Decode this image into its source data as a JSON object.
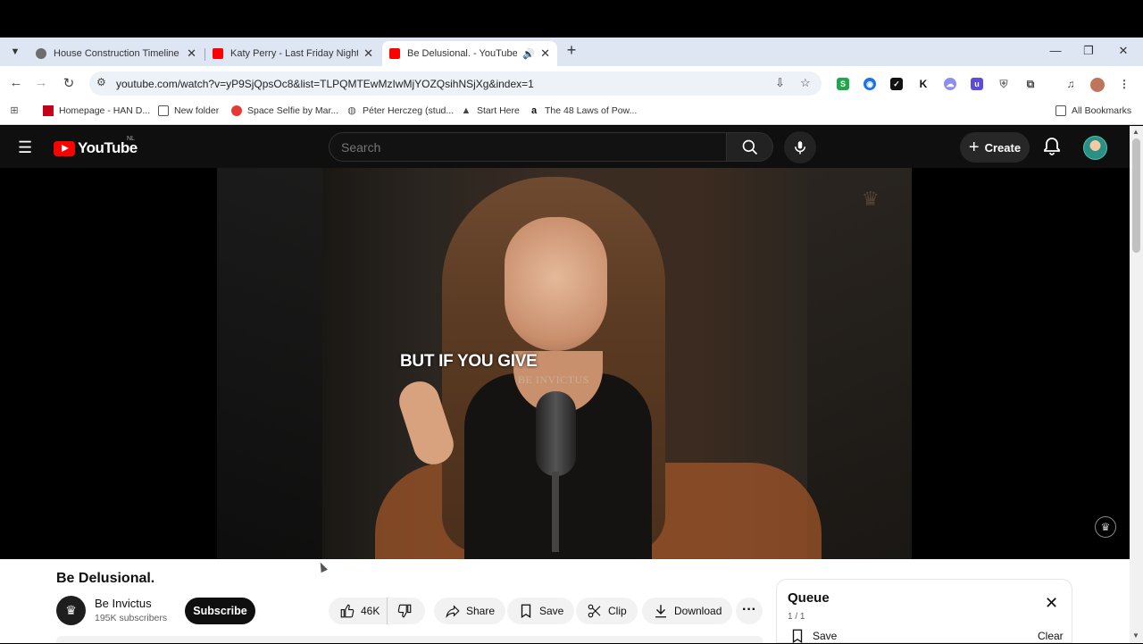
{
  "browser": {
    "tabs": [
      {
        "title": "House Construction Timeline",
        "favicon_color": "#6e6e6e",
        "active": false
      },
      {
        "title": "Katy Perry - Last Friday Night (T",
        "favicon_color": "#ff0000",
        "active": false
      },
      {
        "title": "Be Delusional. - YouTube",
        "favicon_color": "#ff0000",
        "active": true
      }
    ],
    "url": "youtube.com/watch?v=yP9SjQpsOc8&list=TLPQMTEwMzIwMjYOZQsihNSjXg&index=1",
    "bookmarks": [
      {
        "label": "Homepage - HAN D...",
        "icon": "han-icon"
      },
      {
        "label": "New folder",
        "icon": "folder-icon"
      },
      {
        "label": "Space Selfie by Mar...",
        "icon": "space-icon"
      },
      {
        "label": "Péter Herczeg (stud...",
        "icon": "globe-icon"
      },
      {
        "label": "Start Here",
        "icon": "triangle-icon"
      },
      {
        "label": "The 48 Laws of Pow...",
        "icon": "amazon-icon"
      }
    ],
    "all_bookmarks": "All Bookmarks"
  },
  "youtube": {
    "logo_text": "YouTube",
    "country_code": "NL",
    "search_placeholder": "Search",
    "create_label": "Create",
    "video": {
      "caption": "BUT IF YOU GIVE",
      "watermark": "BE INVICTUS"
    },
    "title": "Be Delusional.",
    "channel": {
      "name": "Be Invictus",
      "subscribers": "195K subscribers",
      "subscribe_label": "Subscribe"
    },
    "actions": {
      "likes": "46K",
      "share": "Share",
      "save": "Save",
      "clip": "Clip",
      "download": "Download"
    },
    "queue": {
      "title": "Queue",
      "count": "1 / 1",
      "save": "Save",
      "clear": "Clear"
    }
  }
}
